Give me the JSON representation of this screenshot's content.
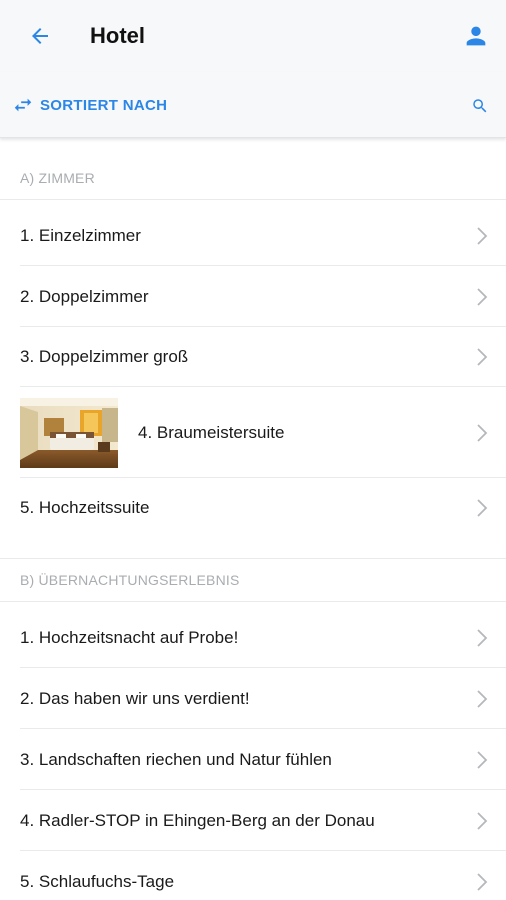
{
  "header": {
    "title": "Hotel",
    "back_icon": "arrow-left-icon",
    "profile_icon": "person-icon"
  },
  "toolbar": {
    "sort_label": "SORTIERT NACH",
    "sort_icon": "swap-arrows-icon",
    "search_icon": "search-icon"
  },
  "colors": {
    "accent": "#2b86e6",
    "section_text": "#a9adb1",
    "divider": "#e8eaec",
    "bar_bg": "#f6f8f9"
  },
  "sections": [
    {
      "title": "A) ZIMMER",
      "items": [
        {
          "label": "1. Einzelzimmer"
        },
        {
          "label": "2. Doppelzimmer"
        },
        {
          "label": "3. Doppelzimmer groß"
        },
        {
          "label": "4. Braumeistersuite",
          "has_image": true
        },
        {
          "label": "5. Hochzeitssuite"
        }
      ]
    },
    {
      "title": "B) ÜBERNACHTUNGSERLEBNIS",
      "items": [
        {
          "label": "1. Hochzeitsnacht auf Probe!"
        },
        {
          "label": "2. Das haben wir uns verdient!"
        },
        {
          "label": "3. Landschaften riechen und Natur fühlen"
        },
        {
          "label": "4. Radler-STOP in Ehingen-Berg an der Donau"
        },
        {
          "label": "5. Schlaufuchs-Tage"
        }
      ]
    }
  ]
}
